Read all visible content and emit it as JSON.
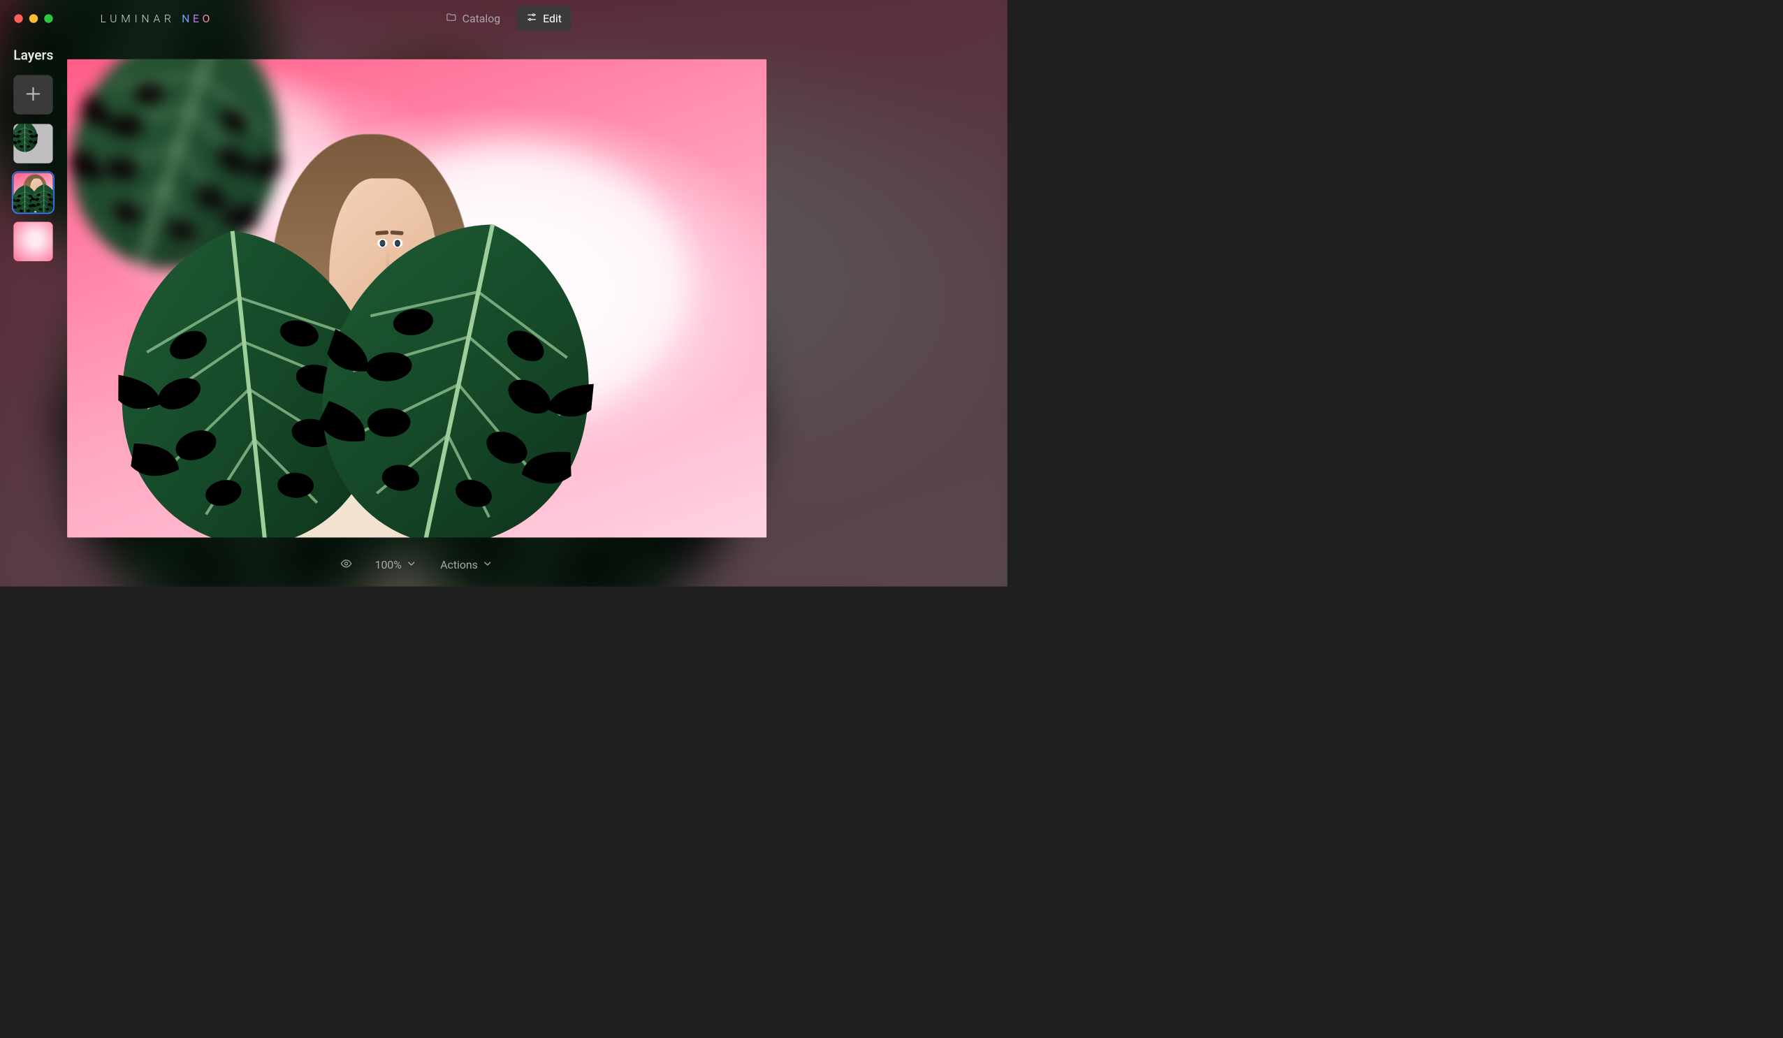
{
  "app": {
    "brand_word1": "LUMINAR",
    "brand_word2": "NEO"
  },
  "modes": {
    "catalog_label": "Catalog",
    "edit_label": "Edit",
    "active": "edit"
  },
  "layers": {
    "panel_title": "Layers",
    "items": [
      {
        "id": "leaf-overlay",
        "selected": false
      },
      {
        "id": "portrait-subject",
        "selected": true
      },
      {
        "id": "pink-sky-background",
        "selected": false
      }
    ]
  },
  "bottombar": {
    "zoom_label": "100%",
    "actions_label": "Actions"
  },
  "colors": {
    "accent": "#2f7fff",
    "leaf_dark": "#123d22",
    "leaf_light": "#2e6a3c",
    "sky_pink": "#ff6c97"
  }
}
